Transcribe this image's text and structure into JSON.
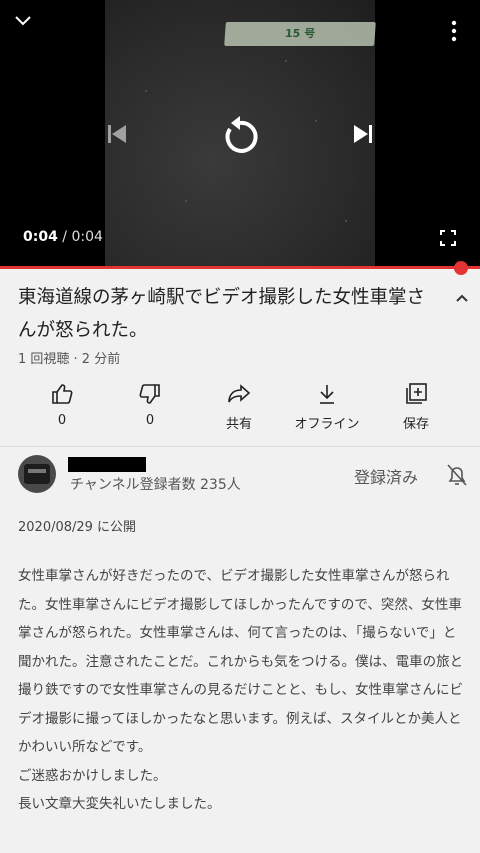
{
  "player": {
    "current_time": "0:04",
    "separator": "/",
    "duration": "0:04",
    "progress": 1.0,
    "sign_text": "15 号",
    "accent_color": "#e33333"
  },
  "video": {
    "title": "東海道線の茅ヶ崎駅でビデオ撮影した女性車掌さんが怒られた。",
    "meta": "1 回視聴 · 2 分前"
  },
  "actions": {
    "like_count": "0",
    "dislike_count": "0",
    "share_label": "共有",
    "offline_label": "オフライン",
    "save_label": "保存"
  },
  "channel": {
    "subscribers": "チャンネル登録者数 235人",
    "subscribe_state": "登録済み"
  },
  "description": {
    "published": "2020/08/29 に公開",
    "body": "女性車掌さんが好きだったので、ビデオ撮影した女性車掌さんが怒られた。女性車掌さんにビデオ撮影してほしかったんですので、突然、女性車掌さんが怒られた。女性車掌さんは、何て言ったのは、「撮らないで」と聞かれた。注意されたことだ。これからも気をつける。僕は、電車の旅と撮り鉄ですので女性車掌さんの見るだけことと、もし、女性車掌さんにビデオ撮影に撮ってほしかったなと思います。例えば、スタイルとか美人とかわいい所などです。\nご迷惑おかけしました。\n長い文章大変失礼いたしました。"
  }
}
